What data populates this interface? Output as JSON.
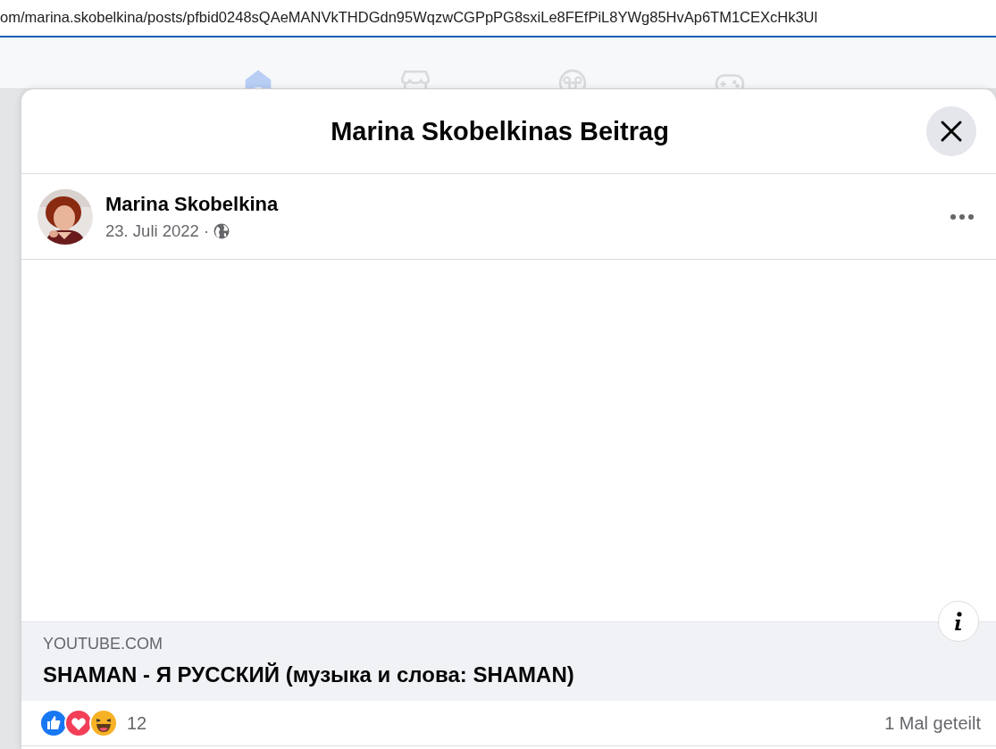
{
  "address_bar": {
    "url": "om/marina.skobelkina/posts/pfbid0248sQAeMANVkTHDGdn95WqzwCGPpPG8sxiLe8FEfPiL8YWg85HvAp6TM1CEXcHk3Ul"
  },
  "nav_tabs": [
    {
      "kind": "home",
      "selected": true
    },
    {
      "kind": "store",
      "selected": false
    },
    {
      "kind": "groups",
      "selected": false
    },
    {
      "kind": "gaming",
      "selected": false
    }
  ],
  "dialog": {
    "title": "Marina Skobelkinas Beitrag"
  },
  "post": {
    "author": "Marina Skobelkina",
    "date": "23. Juli 2022",
    "dot": "·"
  },
  "link_preview": {
    "domain": "YOUTUBE.COM",
    "title": "SHAMAN - Я РУССКИЙ (музыка и слова: SHAMAN)"
  },
  "reactions": {
    "icons": [
      {
        "kind": "like"
      },
      {
        "kind": "love"
      },
      {
        "kind": "haha"
      }
    ],
    "count": "12"
  },
  "shares": "1 Mal geteilt"
}
